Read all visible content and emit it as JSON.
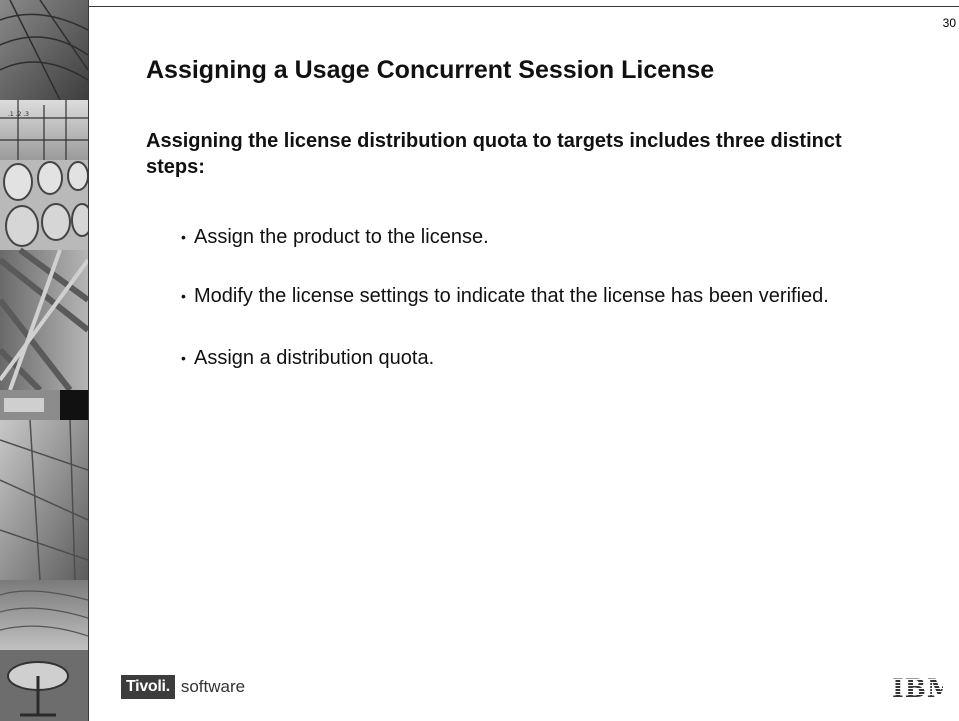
{
  "slide": {
    "page_number": "30",
    "title": "Assigning a Usage Concurrent Session License",
    "subtitle": "Assigning the license distribution quota to targets includes three distinct steps:",
    "bullets": [
      "Assign the product to the license.",
      "Modify the license settings to indicate that the license has been verified.",
      "Assign a distribution quota."
    ]
  },
  "footer": {
    "brand_box": "Tivoli.",
    "brand_text": "software",
    "company_logo": "IBM"
  }
}
